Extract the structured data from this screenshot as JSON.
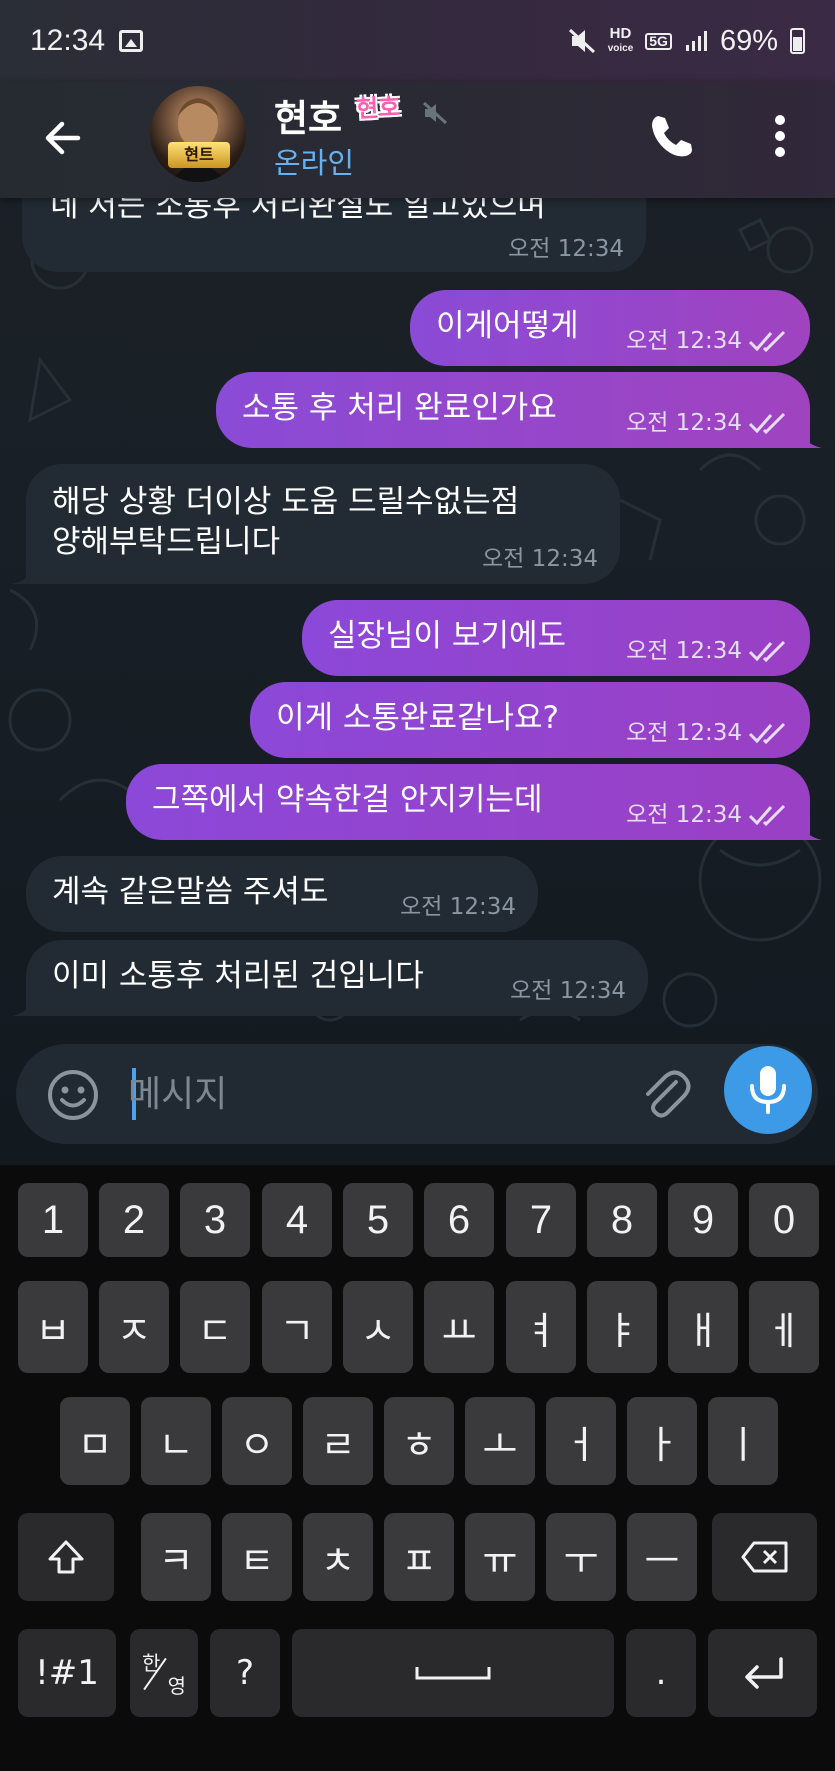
{
  "status_bar": {
    "time": "12:34",
    "hd_label": "HD",
    "voice_label": "voice",
    "network": "5G",
    "battery_percent": "69%"
  },
  "header": {
    "contact_name": "현호",
    "name_sticker": "현호",
    "avatar_badge": "현트",
    "contact_status": "온라인",
    "icons": [
      "back-arrow-icon",
      "mute-icon",
      "phone-icon",
      "more-vertical-icon"
    ]
  },
  "messages": [
    {
      "dir": "in",
      "text": "네 저는 소통후 처리완절도 알고있으며",
      "time": "오전 12:34"
    },
    {
      "dir": "out",
      "text": "이게어떻게",
      "time": "오전 12:34",
      "read": true
    },
    {
      "dir": "out",
      "text": "소통 후 처리 완료인가요",
      "time": "오전 12:34",
      "read": true
    },
    {
      "dir": "in",
      "text": "해당 상황 더이상 도움 드릴수없는점\n양해부탁드립니다",
      "line1": "해당 상황 더이상 도움 드릴수없는점",
      "line2": "양해부탁드립니다",
      "time": "오전 12:34"
    },
    {
      "dir": "out",
      "text": "실장님이 보기에도",
      "time": "오전 12:34",
      "read": true
    },
    {
      "dir": "out",
      "text": "이게 소통완료같나요?",
      "time": "오전 12:34",
      "read": true
    },
    {
      "dir": "out",
      "text": "그쪽에서 약속한걸 안지키는데",
      "time": "오전 12:34",
      "read": true
    },
    {
      "dir": "in",
      "text": "계속 같은말씀 주셔도",
      "time": "오전 12:34"
    },
    {
      "dir": "in",
      "text": "이미 소통후 처리된 건입니다",
      "time": "오전 12:34"
    }
  ],
  "composer": {
    "placeholder": "메시지",
    "icons": [
      "emoji-icon",
      "attach-icon",
      "mic-icon"
    ]
  },
  "keyboard": {
    "row_numbers": [
      "1",
      "2",
      "3",
      "4",
      "5",
      "6",
      "7",
      "8",
      "9",
      "0"
    ],
    "row1": [
      "ㅂ",
      "ㅈ",
      "ㄷ",
      "ㄱ",
      "ㅅ",
      "ㅛ",
      "ㅕ",
      "ㅑ",
      "ㅐ",
      "ㅔ"
    ],
    "row2": [
      "ㅁ",
      "ㄴ",
      "ㅇ",
      "ㄹ",
      "ㅎ",
      "ㅗ",
      "ㅓ",
      "ㅏ",
      "ㅣ"
    ],
    "row3": [
      "ㅋ",
      "ㅌ",
      "ㅊ",
      "ㅍ",
      "ㅠ",
      "ㅜ",
      "ㅡ"
    ],
    "symbols_label": "!#1",
    "lang_top": "한",
    "lang_bottom": "영",
    "question_label": "?",
    "period_label": ".",
    "icons": [
      "shift-icon",
      "backspace-icon",
      "space-icon",
      "enter-icon"
    ]
  }
}
